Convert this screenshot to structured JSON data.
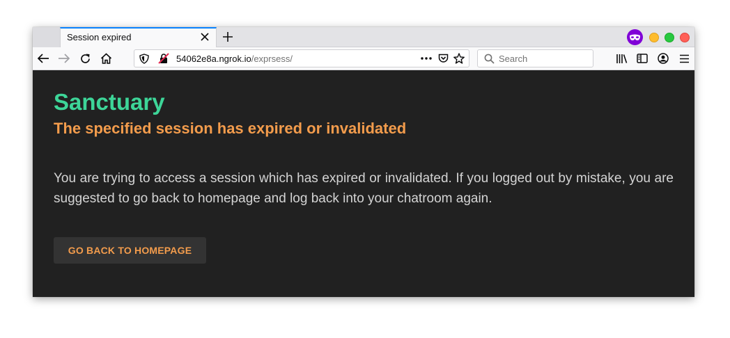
{
  "browser": {
    "tab": {
      "title": "Session expired"
    },
    "url": {
      "host": "54062e8a.ngrok.io",
      "path": "/exprsess/"
    },
    "search": {
      "placeholder": "Search"
    },
    "accent_color": "#0a84ff",
    "private_icon_color": "#8000d7"
  },
  "page": {
    "title": "Sanctuary",
    "subtitle": "The specified session has expired or invalidated",
    "message": "You are trying to access a session which has expired or invalidated. If you logged out by mistake, you are suggested to go back to homepage and log back into your chatroom again.",
    "button_label": "GO BACK TO HOMEPAGE",
    "colors": {
      "background": "#212121",
      "title": "#3dd598",
      "subtitle": "#f39c4c",
      "text": "#d4d4d4",
      "button_bg": "#333333",
      "button_text": "#f39c4c"
    }
  }
}
